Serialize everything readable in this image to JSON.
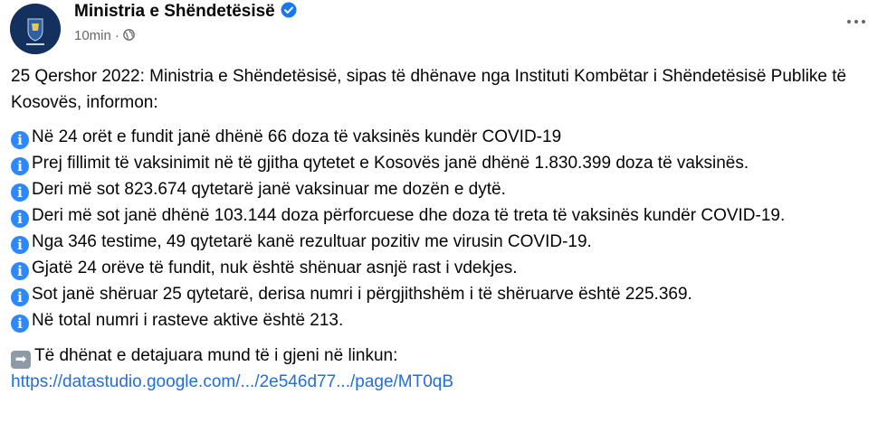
{
  "header": {
    "page_name": "Ministria e Shëndetësisë",
    "time": "10min",
    "separator": "·"
  },
  "post": {
    "intro": "25 Qershor 2022: Ministria e Shëndetësisë, sipas të dhënave nga Instituti Kombëtar i Shëndetësisë Publike të Kosovës, informon:",
    "items": [
      "Në 24 orët e fundit janë dhënë 66 doza të vaksinës kundër COVID-19",
      "Prej fillimit të vaksinimit në të gjitha qytetet e Kosovës janë dhënë 1.830.399 doza të vaksinës.",
      "Deri më sot 823.674 qytetarë janë vaksinuar me dozën e dytë.",
      "Deri më sot janë dhënë 103.144 doza përforcuese dhe doza të treta të vaksinës kundër COVID-19.",
      "Nga 346 testime, 49 qytetarë kanë rezultuar pozitiv me virusin COVID-19.",
      "Gjatë 24 orëve të fundit, nuk është shënuar asnjë rast i vdekjes.",
      "Sot janë shëruar 25 qytetarë, derisa numri i përgjithshëm i të shëruarve është 225.369.",
      "Në total numri i rasteve aktive është 213."
    ],
    "details_text": "Të dhënat e detajuara mund të i gjeni në linkun:",
    "link_text": "https://datastudio.google.com/.../2e546d77.../page/MT0qB"
  },
  "icons": {
    "info": "information-icon",
    "arrow": "right-arrow-icon",
    "more": "more-options-icon",
    "globe": "globe-icon",
    "verified": "verified-badge-icon"
  },
  "colors": {
    "info_icon": "#2d88ff",
    "link": "#216fdb",
    "verified": "#1877f2",
    "meta": "#65676b"
  }
}
